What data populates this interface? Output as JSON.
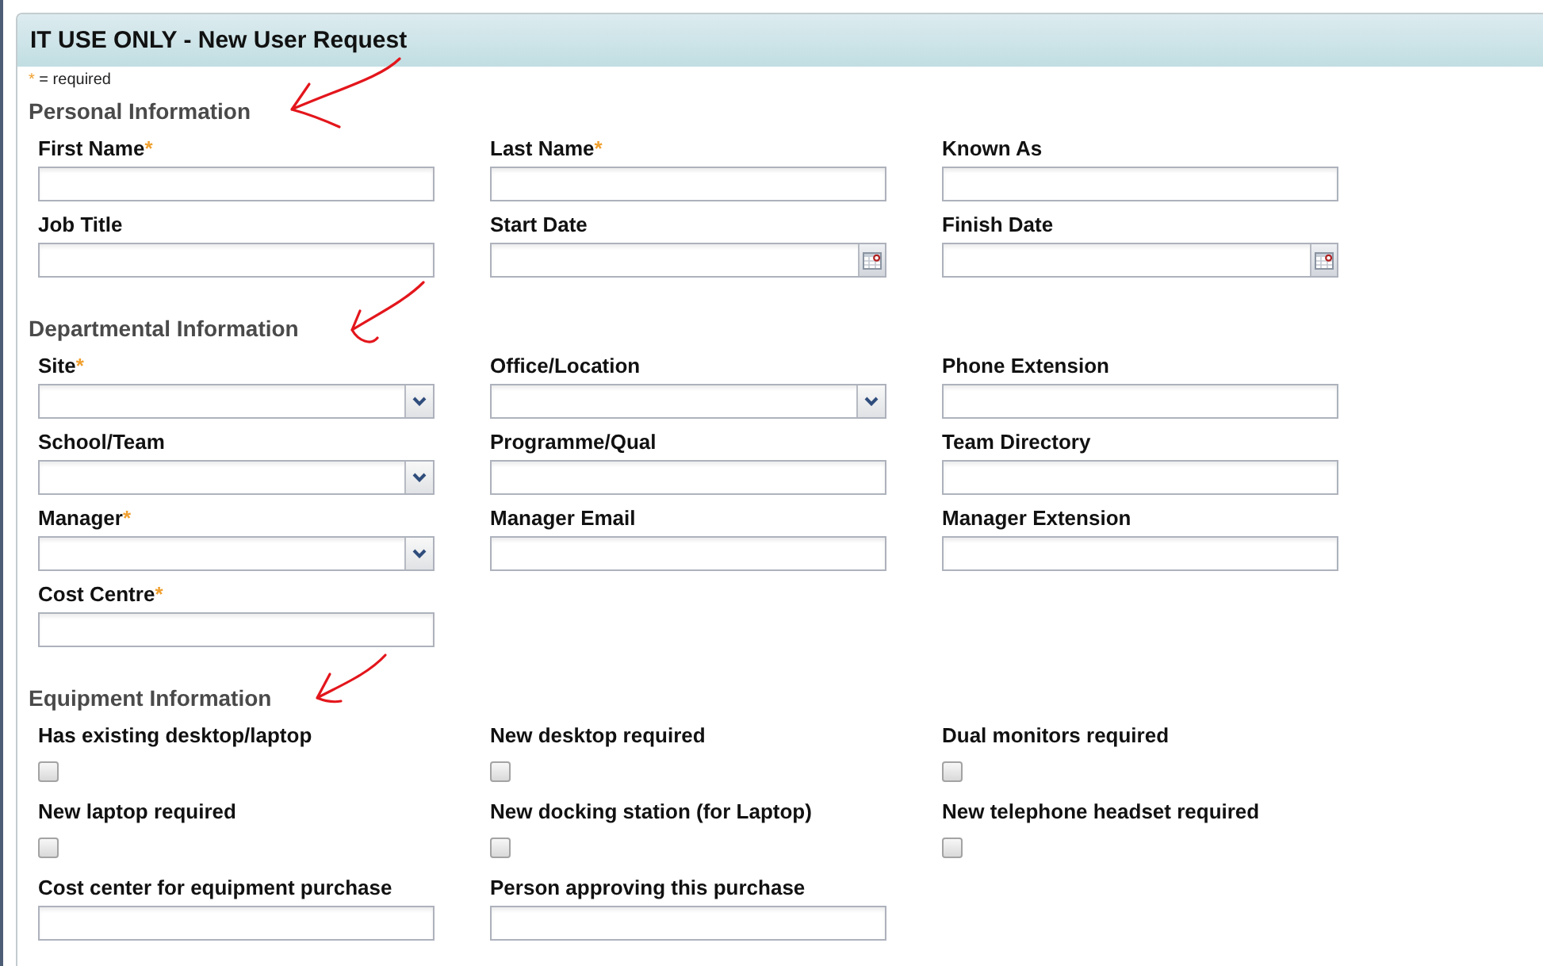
{
  "window": {
    "title": "IT USE ONLY - New User Request"
  },
  "required_note": {
    "mark": "*",
    "text": "= required"
  },
  "sections": [
    {
      "title": "Personal Information",
      "annotation_arrow": true,
      "fields": [
        {
          "label": "First Name",
          "required_mark": "*",
          "kind": "text"
        },
        {
          "label": "Last Name",
          "required_mark": "*",
          "kind": "text"
        },
        {
          "label": "Known As",
          "kind": "text"
        },
        {
          "label": "Job Title",
          "kind": "text"
        },
        {
          "label": "Start Date",
          "kind": "date"
        },
        {
          "label": "Finish Date",
          "kind": "date"
        }
      ]
    },
    {
      "title": "Departmental Information",
      "annotation_arrow": true,
      "fields": [
        {
          "label": "Site",
          "required_mark": "*",
          "kind": "select"
        },
        {
          "label": "Office/Location",
          "kind": "select"
        },
        {
          "label": "Phone Extension",
          "kind": "text"
        },
        {
          "label": "School/Team",
          "kind": "select"
        },
        {
          "label": "Programme/Qual",
          "kind": "text"
        },
        {
          "label": "Team Directory",
          "kind": "text"
        },
        {
          "label": "Manager",
          "required_mark": "*",
          "kind": "select"
        },
        {
          "label": "Manager Email",
          "kind": "text"
        },
        {
          "label": "Manager Extension",
          "kind": "text"
        },
        {
          "label": "Cost Centre",
          "required_mark": "*",
          "kind": "text"
        }
      ]
    },
    {
      "title": "Equipment Information",
      "annotation_arrow": true,
      "fields": [
        {
          "label": "Has existing desktop/laptop",
          "kind": "checkbox",
          "checked": false
        },
        {
          "label": "New desktop required",
          "kind": "checkbox",
          "checked": false
        },
        {
          "label": "Dual monitors required",
          "kind": "checkbox",
          "checked": false
        },
        {
          "label": "New laptop required",
          "kind": "checkbox",
          "checked": false
        },
        {
          "label": "New docking station (for Laptop)",
          "kind": "checkbox",
          "checked": false
        },
        {
          "label": "New telephone headset required",
          "kind": "checkbox",
          "checked": false
        },
        {
          "label": "Cost center for equipment purchase",
          "kind": "text"
        },
        {
          "label": "Person approving this purchase",
          "kind": "text"
        }
      ]
    }
  ]
}
